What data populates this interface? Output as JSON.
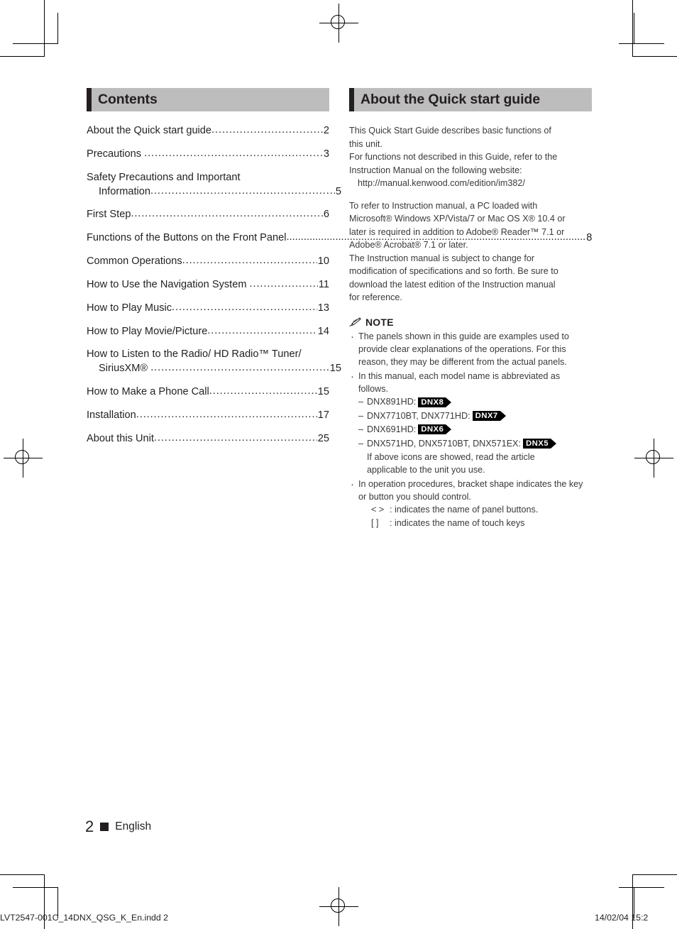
{
  "contents": {
    "header": "Contents",
    "entries": [
      {
        "label": "About the Quick start guide",
        "page": "2"
      },
      {
        "label": "Precautions ",
        "page": "3"
      },
      {
        "label": "Safety Precautions and Important",
        "label2": "Information",
        "page": "5"
      },
      {
        "label": "First Step",
        "page": "6"
      },
      {
        "label": "Functions of the Buttons on the Front Panel",
        "page": "8",
        "noleader": true
      },
      {
        "label": "Common Operations",
        "page": "10"
      },
      {
        "label": "How to Use the Navigation System ",
        "page": "11"
      },
      {
        "label": "How to Play Music",
        "page": "13"
      },
      {
        "label": "How to Play Movie/Picture",
        "page": "14"
      },
      {
        "label": "How to Listen to the Radio/ HD Radio™ Tuner/",
        "label2": "SiriusXM® ",
        "page": "15"
      },
      {
        "label": "How to Make a Phone Call",
        "page": "15"
      },
      {
        "label": "Installation",
        "page": "17"
      },
      {
        "label": "About this Unit",
        "page": "25"
      }
    ]
  },
  "about": {
    "header": "About the Quick start guide",
    "intro_lines": [
      "This Quick Start Guide describes basic functions of",
      "this unit.",
      "For functions not described in this Guide, refer to the",
      "Instruction Manual on the following website:"
    ],
    "url": "http://manual.kenwood.com/edition/im382/",
    "second_lines": [
      "To refer to Instruction manual, a PC loaded with",
      "Microsoft® Windows XP/Vista/7 or Mac OS X® 10.4 or",
      "later is required in addition to Adobe® Reader™ 7.1 or",
      "Adobe® Acrobat® 7.1 or later.",
      "The Instruction manual is subject to change for",
      "modification of specifications and so forth. Be sure to",
      "download the latest edition of the Instruction manual",
      "for reference."
    ],
    "note_label": "NOTE",
    "note_icon": "pencil-icon",
    "notes": [
      {
        "text": "The panels shown in this guide are examples used to provide clear explanations of the operations. For this reason, they may be different from the actual panels."
      },
      {
        "text": "In this manual, each model name is abbreviated as follows.",
        "models": [
          {
            "names": "DNX891HD:",
            "badge": "DNX8"
          },
          {
            "names": "DNX7710BT, DNX771HD:",
            "badge": "DNX7"
          },
          {
            "names": "DNX691HD:",
            "badge": "DNX6"
          },
          {
            "names": "DNX571HD, DNX5710BT, DNX571EX:",
            "badge": "DNX5"
          }
        ],
        "model_note_lines": [
          "If above icons are showed, read the article",
          "applicable to the unit you use."
        ]
      },
      {
        "text": "In operation procedures, bracket shape indicates the key or button you should control.",
        "brackets": [
          {
            "symbol": "<      >",
            "desc": ": indicates the name of panel buttons."
          },
          {
            "symbol": "[      ]",
            "desc": ": indicates the name of touch keys"
          }
        ]
      }
    ]
  },
  "footer": {
    "page_number": "2",
    "language": "English",
    "print_left": "LVT2547-001C_14DNX_QSG_K_En.indd   2",
    "print_right": "14/02/04   15:2"
  },
  "colors": {
    "header_bg": "#bdbdbd",
    "accent": "#231f20",
    "body_text": "#3a3a3c"
  }
}
